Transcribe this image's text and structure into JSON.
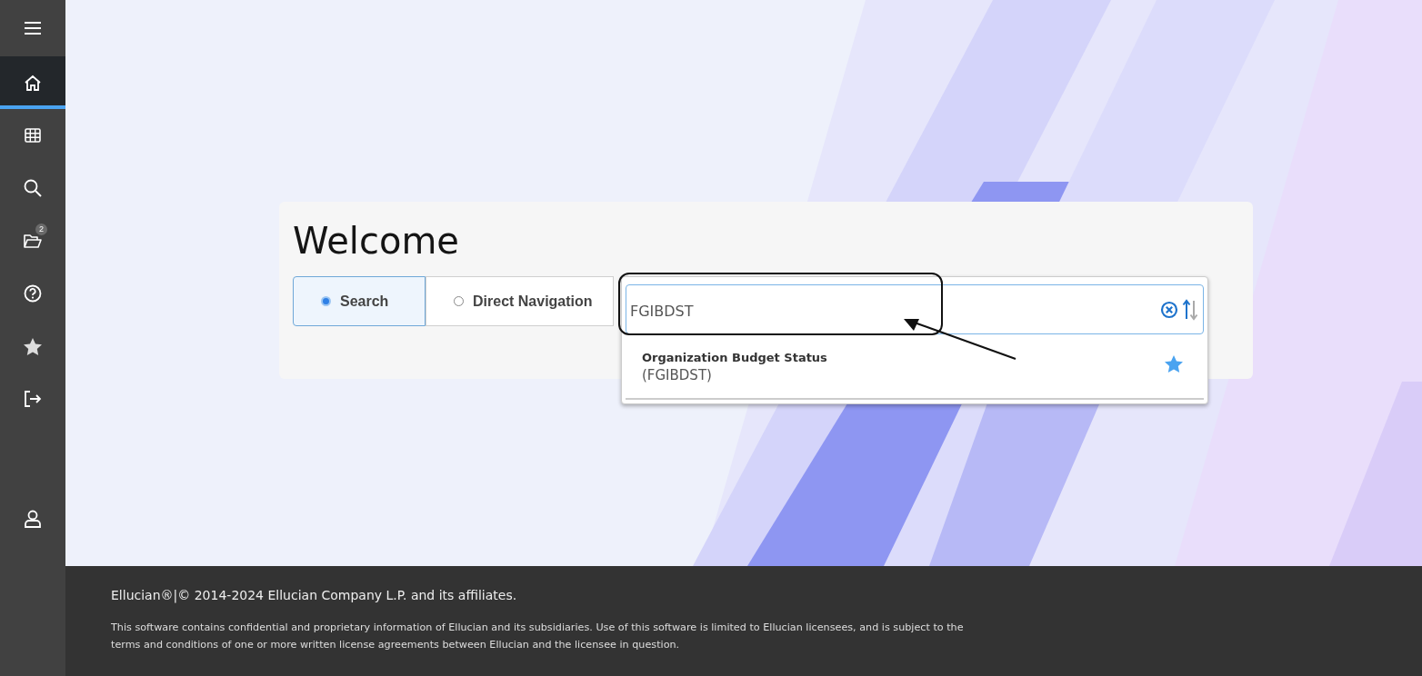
{
  "sidebar": {
    "items": [
      {
        "selected": false
      },
      {
        "selected": true
      },
      {
        "selected": false
      },
      {
        "selected": false
      },
      {
        "selected": false,
        "badge": "2"
      },
      {
        "selected": false
      },
      {
        "selected": false
      },
      {
        "selected": false
      },
      {
        "selected": false
      }
    ]
  },
  "welcome": {
    "title": "Welcome",
    "modes": [
      {
        "label": "Search",
        "selected": true
      },
      {
        "label": "Direct Navigation",
        "selected": false
      }
    ],
    "search": {
      "value": "FGIBDST"
    },
    "results": [
      {
        "title": "Organization Budget Status",
        "code": "(FGIBDST)",
        "favorite": true
      }
    ]
  },
  "annotation": {
    "highlight": true,
    "arrow": true
  },
  "footer": {
    "copyright": "Ellucian®|© 2014-2024 Ellucian Company L.P. and its affiliates.",
    "notice": "This software contains confidential and proprietary information of Ellucian and its subsidiaries. Use of this software is limited to Ellucian licensees, and is subject to the terms and conditions of one or more written license agreements between Ellucian and the licensee in question."
  }
}
